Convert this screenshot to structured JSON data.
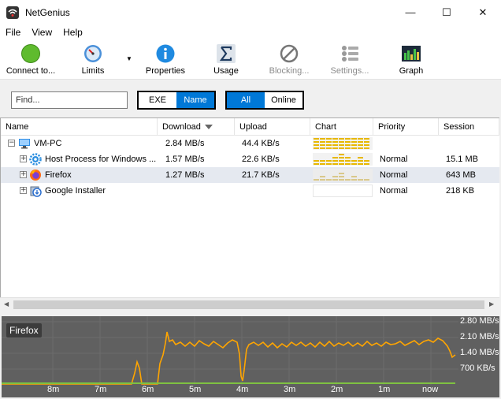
{
  "window": {
    "title": "NetGenius",
    "minimize_glyph": "—",
    "maximize_glyph": "☐",
    "close_glyph": "✕"
  },
  "menu": [
    "File",
    "View",
    "Help"
  ],
  "toolbar": {
    "connect": "Connect to...",
    "limits": "Limits",
    "properties": "Properties",
    "usage": "Usage",
    "blocking": "Blocking...",
    "settings": "Settings...",
    "graph": "Graph",
    "dropdown_glyph": "▼"
  },
  "filter": {
    "find_placeholder": "Find...",
    "mode_options": [
      "EXE",
      "Name"
    ],
    "mode_selected": "Name",
    "scope_options": [
      "All",
      "Online"
    ],
    "scope_selected": "All"
  },
  "table": {
    "columns": [
      "Name",
      "Download",
      "Upload",
      "Chart",
      "Priority",
      "Session"
    ],
    "sort_column": "Download",
    "rows": [
      {
        "name": "VM-PC",
        "download": "2.84 MB/s",
        "upload": "44.4 KB/s",
        "priority": "",
        "session": "",
        "expander": "−",
        "icon": "computer-icon"
      },
      {
        "name": "Host Process for Windows ...",
        "download": "1.57 MB/s",
        "upload": "22.6 KB/s",
        "priority": "Normal",
        "session": "15.1 MB",
        "expander": "+",
        "icon": "gear-icon"
      },
      {
        "name": "Firefox",
        "download": "1.27 MB/s",
        "upload": "21.7 KB/s",
        "priority": "Normal",
        "session": "643 MB",
        "expander": "+",
        "icon": "firefox-icon",
        "selected": true
      },
      {
        "name": "Google Installer",
        "download": "",
        "upload": "",
        "priority": "Normal",
        "session": "218 KB",
        "expander": "+",
        "icon": "installer-icon"
      }
    ]
  },
  "scrollbar": {
    "left_glyph": "◀",
    "right_glyph": "▶"
  },
  "graph": {
    "label": "Firefox",
    "y_labels": [
      "2.80 MB/s",
      "2.10 MB/s",
      "1.40 MB/s",
      "700 KB/s"
    ],
    "x_labels": [
      "8m",
      "7m",
      "6m",
      "5m",
      "4m",
      "3m",
      "2m",
      "1m",
      "now"
    ],
    "colors": {
      "download": "#ffa500",
      "upload": "#7fc241",
      "background": "#606060"
    }
  }
}
